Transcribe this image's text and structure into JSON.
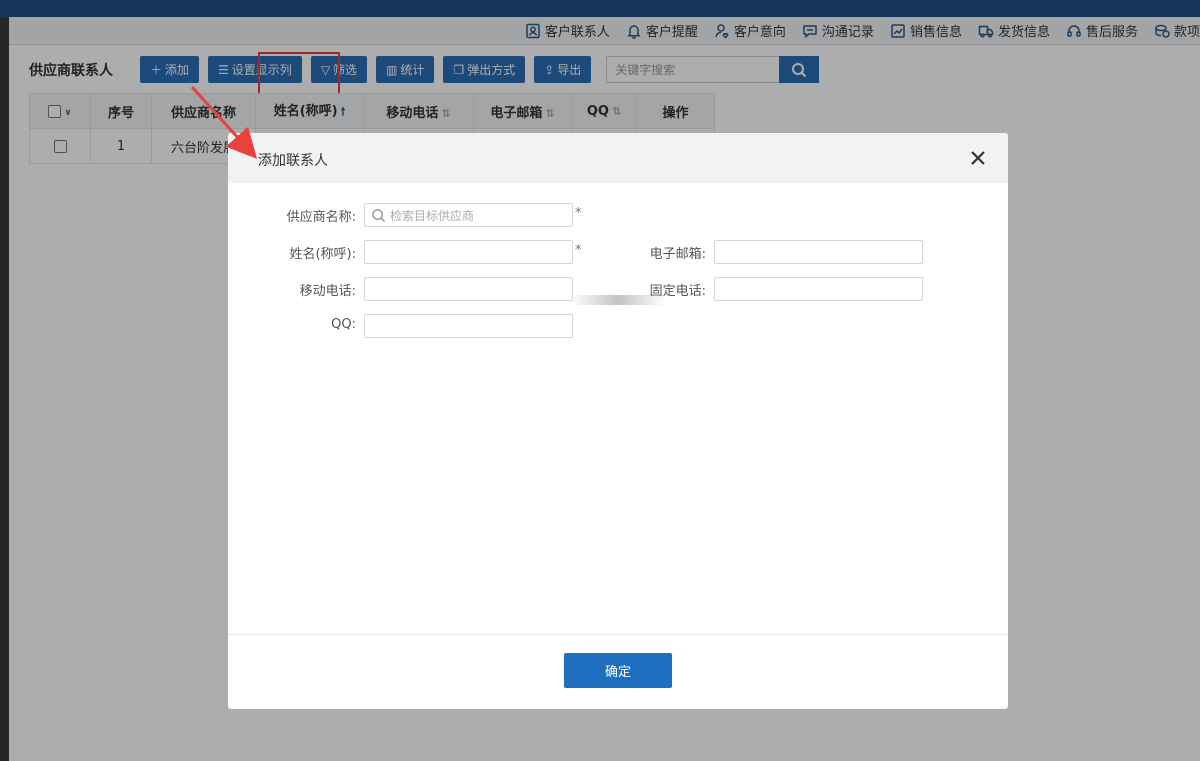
{
  "nav": {
    "items": [
      {
        "label": "客户联系人",
        "icon": "contact-card-icon"
      },
      {
        "label": "客户提醒",
        "icon": "bell-icon"
      },
      {
        "label": "客户意向",
        "icon": "user-heart-icon"
      },
      {
        "label": "沟通记录",
        "icon": "chat-bubble-icon"
      },
      {
        "label": "销售信息",
        "icon": "chart-frame-icon"
      },
      {
        "label": "发货信息",
        "icon": "truck-icon"
      },
      {
        "label": "售后服务",
        "icon": "headset-icon"
      },
      {
        "label": "款项",
        "icon": "coins-icon"
      }
    ]
  },
  "page": {
    "title": "供应商联系人"
  },
  "toolbar": {
    "add": "添加",
    "columns": "设置显示列",
    "filter": "筛选",
    "stats": "统计",
    "popup": "弹出方式",
    "export": "导出",
    "search_placeholder": "关键字搜索"
  },
  "table": {
    "headers": [
      "序号",
      "供应商名称",
      "姓名(称呼)",
      "移动电话",
      "电子邮箱",
      "QQ",
      "操作"
    ],
    "rows": [
      {
        "index": "1",
        "supplier": "六台阶发展"
      }
    ]
  },
  "modal": {
    "title": "添加联系人",
    "fields": {
      "supplier_label": "供应商名称:",
      "supplier_placeholder": "检索目标供应商",
      "name_label": "姓名(称呼):",
      "email_label": "电子邮箱:",
      "mobile_label": "移动电话:",
      "phone_label": "固定电话:",
      "qq_label": "QQ:",
      "required_mark": "*"
    },
    "confirm": "确定"
  },
  "colors": {
    "primary": "#2a6fb5",
    "topbar": "#1f4f82",
    "highlight": "#e8423c",
    "link": "#1f5fa8"
  }
}
